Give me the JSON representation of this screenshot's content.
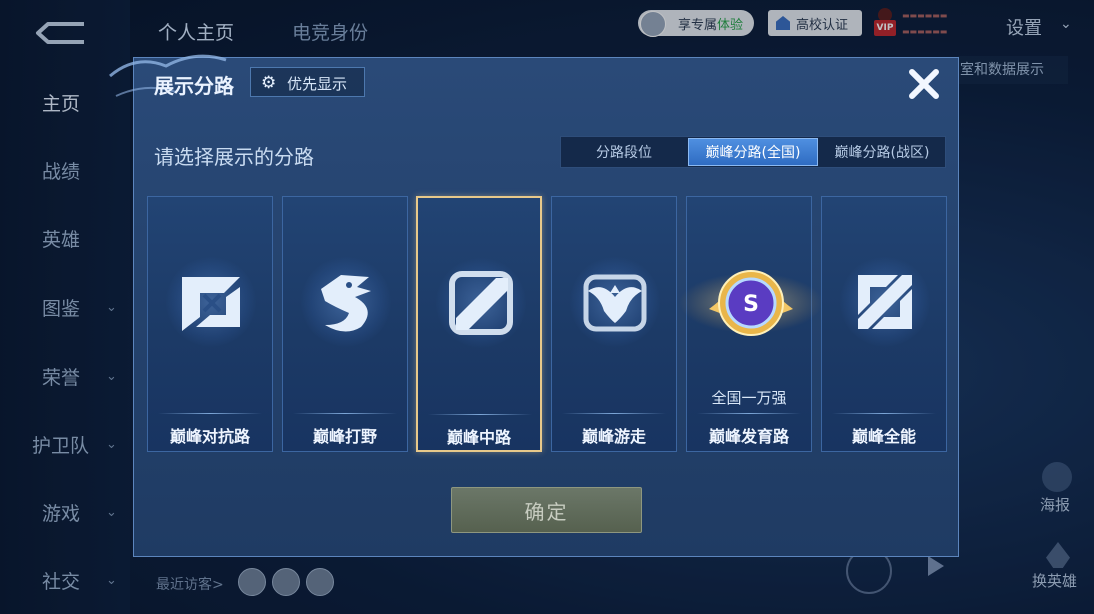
{
  "background": {
    "top_tabs": [
      "个人主页",
      "电竞身份"
    ],
    "sidebar_items": [
      {
        "label": "主页",
        "chevron": false,
        "active": true
      },
      {
        "label": "战绩",
        "chevron": false
      },
      {
        "label": "英雄",
        "chevron": false
      },
      {
        "label": "图鉴",
        "chevron": true
      },
      {
        "label": "荣誉",
        "chevron": true
      },
      {
        "label": "护卫队",
        "chevron": true
      },
      {
        "label": "游戏",
        "chevron": true
      },
      {
        "label": "社交",
        "chevron": true
      }
    ],
    "vip_pill": {
      "prefix": "享专属",
      "highlight": "体验"
    },
    "school_pill": "高校认证",
    "vip_badge": "VIP",
    "settings_label": "设置",
    "right_strip_text": "室和数据展示",
    "poster_label": "海报",
    "swap_hero_label": "换英雄",
    "recent_visitors_label": "最近访客>"
  },
  "modal": {
    "title": "展示分路",
    "priority_button": "优先显示",
    "subtitle": "请选择展示的分路",
    "segments": [
      {
        "label": "分路段位",
        "active": false
      },
      {
        "label": "巅峰分路(全国)",
        "active": true
      },
      {
        "label": "巅峰分路(战区)",
        "active": false
      }
    ],
    "cards": [
      {
        "label": "巅峰对抗路",
        "icon": "clash-lane-icon",
        "selected": false,
        "rank": ""
      },
      {
        "label": "巅峰打野",
        "icon": "jungle-dragon-icon",
        "selected": false,
        "rank": ""
      },
      {
        "label": "巅峰中路",
        "icon": "mid-lane-icon",
        "selected": true,
        "rank": ""
      },
      {
        "label": "巅峰游走",
        "icon": "roam-wings-icon",
        "selected": false,
        "rank": ""
      },
      {
        "label": "巅峰发育路",
        "icon": "farm-lane-badge-icon",
        "selected": false,
        "rank": "全国一万强"
      },
      {
        "label": "巅峰全能",
        "icon": "all-round-icon",
        "selected": false,
        "rank": ""
      }
    ],
    "confirm_button": "确定"
  },
  "colors": {
    "accent": "#3f7fd6",
    "selected_border": "#e8c98a",
    "modal_bg": "#24426d"
  }
}
